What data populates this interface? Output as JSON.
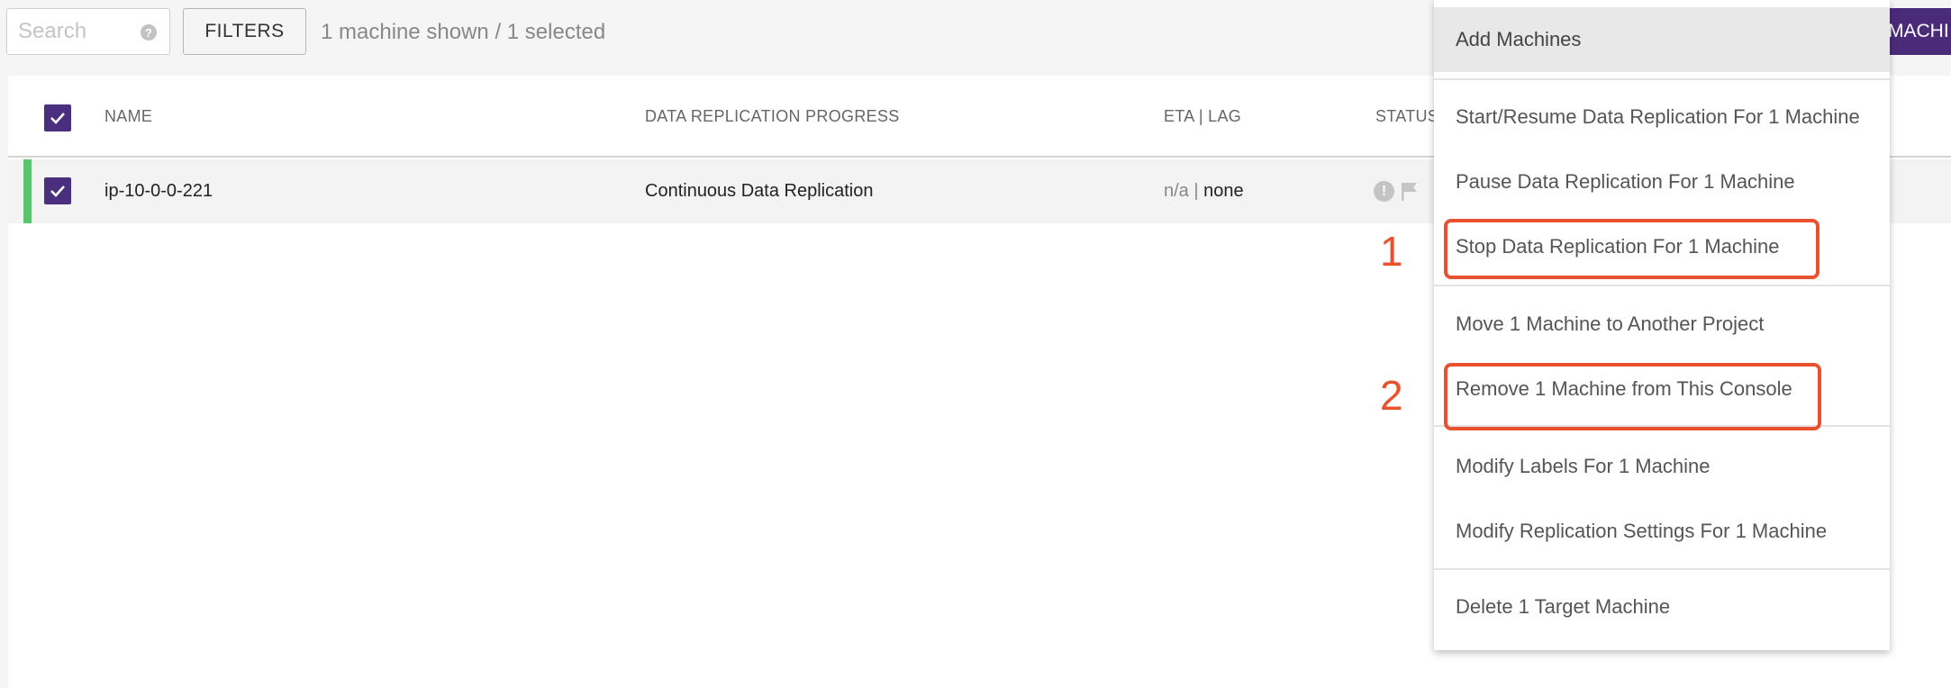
{
  "toolbar": {
    "search_placeholder": "Search",
    "filters_label": "FILTERS",
    "count_text": "1 machine shown / 1 selected",
    "right_button_label": "MACHI"
  },
  "table": {
    "columns": {
      "name": "NAME",
      "progress": "DATA REPLICATION PROGRESS",
      "eta": "ETA | LAG",
      "status": "STATUS"
    },
    "rows": [
      {
        "name": "ip-10-0-0-221",
        "progress": "Continuous Data Replication",
        "eta": "n/a",
        "lag": "none",
        "selected": true
      }
    ]
  },
  "menu": {
    "items": [
      "Add Machines",
      "Start/Resume Data Replication For 1 Machine",
      "Pause Data Replication For 1 Machine",
      "Stop Data Replication For 1 Machine",
      "Move 1 Machine to Another Project",
      "Remove 1 Machine from This Console",
      "Modify Labels For 1 Machine",
      "Modify Replication Settings For 1 Machine",
      "Delete 1 Target Machine"
    ]
  },
  "annotations": {
    "label_1": "1",
    "label_2": "2",
    "color": "#e8522f"
  },
  "colors": {
    "accent": "#4a2f7f",
    "row_marker": "#5cc46c"
  },
  "icons": [
    "help-icon",
    "check-icon",
    "alert-icon",
    "flag-icon"
  ]
}
